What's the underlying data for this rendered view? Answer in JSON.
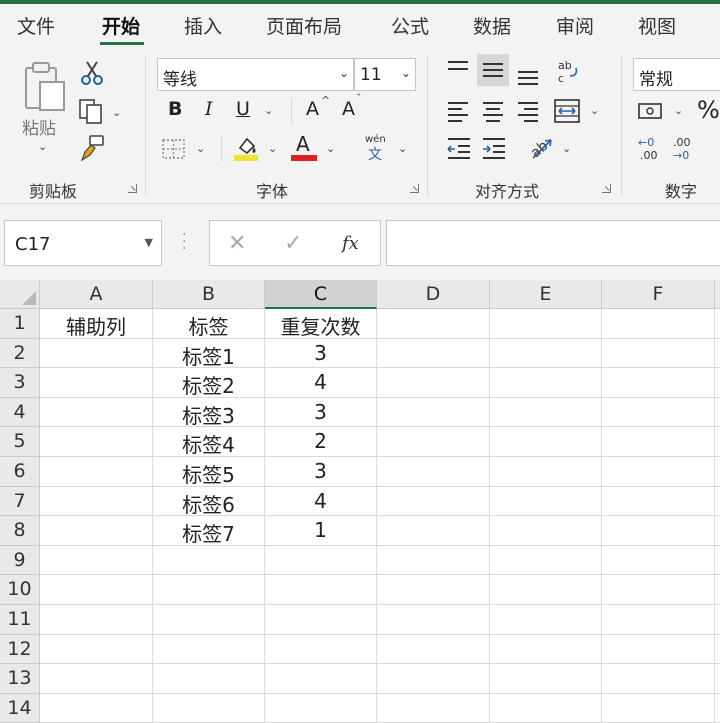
{
  "tabs": [
    "文件",
    "开始",
    "插入",
    "页面布局",
    "公式",
    "数据",
    "审阅",
    "视图"
  ],
  "active_tab": "开始",
  "ribbon": {
    "clipboard": {
      "label": "剪贴板",
      "paste": "粘贴"
    },
    "font": {
      "label": "字体",
      "font_name": "等线",
      "font_size": "11",
      "bold": "B",
      "italic": "I",
      "underline": "U",
      "grow": "A",
      "shrink": "A",
      "font_color": "A",
      "highlight_color": "#f5e22b",
      "font_color_hex": "#e02020",
      "phonetic_top": "wén",
      "phonetic_bottom": "文"
    },
    "alignment": {
      "label": "对齐方式"
    },
    "number": {
      "label": "数字",
      "format": "常规",
      "percent": "%"
    }
  },
  "formula_bar": {
    "name_box": "C17",
    "fx": "fx",
    "formula": ""
  },
  "sheet": {
    "columns": [
      "A",
      "B",
      "C",
      "D",
      "E",
      "F"
    ],
    "selected_column": "C",
    "rows": [
      "1",
      "2",
      "3",
      "4",
      "5",
      "6",
      "7",
      "8",
      "9",
      "10",
      "11",
      "12",
      "13",
      "14"
    ],
    "cells": [
      [
        "辅助列",
        "标签",
        "重复次数",
        "",
        "",
        ""
      ],
      [
        "",
        "标签1",
        "3",
        "",
        "",
        ""
      ],
      [
        "",
        "标签2",
        "4",
        "",
        "",
        ""
      ],
      [
        "",
        "标签3",
        "3",
        "",
        "",
        ""
      ],
      [
        "",
        "标签4",
        "2",
        "",
        "",
        ""
      ],
      [
        "",
        "标签5",
        "3",
        "",
        "",
        ""
      ],
      [
        "",
        "标签6",
        "4",
        "",
        "",
        ""
      ],
      [
        "",
        "标签7",
        "1",
        "",
        "",
        ""
      ],
      [
        "",
        "",
        "",
        "",
        "",
        ""
      ],
      [
        "",
        "",
        "",
        "",
        "",
        ""
      ],
      [
        "",
        "",
        "",
        "",
        "",
        ""
      ],
      [
        "",
        "",
        "",
        "",
        "",
        ""
      ],
      [
        "",
        "",
        "",
        "",
        "",
        ""
      ],
      [
        "",
        "",
        "",
        "",
        "",
        ""
      ]
    ]
  }
}
